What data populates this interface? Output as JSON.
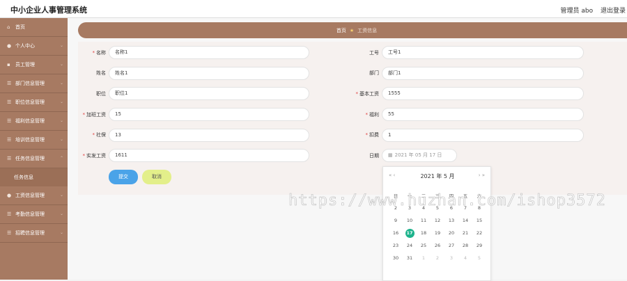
{
  "header": {
    "title": "中小企业人事管理系统",
    "user_label": "管理员 abo",
    "logout_label": "退出登录"
  },
  "sidebar": {
    "items": [
      {
        "label": "首页",
        "icon": "home-icon"
      },
      {
        "label": "个人中心",
        "icon": "user-icon"
      },
      {
        "label": "员工管理",
        "icon": "users-icon"
      },
      {
        "label": "部门信息管理",
        "icon": "list-icon"
      },
      {
        "label": "职位信息管理",
        "icon": "list-icon"
      },
      {
        "label": "福利信息管理",
        "icon": "list-icon"
      },
      {
        "label": "培训信息管理",
        "icon": "list-icon"
      },
      {
        "label": "任务信息管理",
        "icon": "list-icon"
      },
      {
        "label": "工资信息管理",
        "icon": "user-icon"
      },
      {
        "label": "考勤信息管理",
        "icon": "list-icon"
      },
      {
        "label": "招聘信息管理",
        "icon": "list-icon"
      }
    ],
    "sub_item": "任务信息"
  },
  "breadcrumb": {
    "home": "首页",
    "current": "工资信息"
  },
  "form": {
    "name": {
      "label": "名称",
      "value": "名称1"
    },
    "job_no": {
      "label": "工号",
      "value": "工号1"
    },
    "person_name": {
      "label": "姓名",
      "value": "姓名1"
    },
    "dept": {
      "label": "部门",
      "value": "部门1"
    },
    "position": {
      "label": "职位",
      "value": "职位1"
    },
    "base_salary": {
      "label": "基本工资",
      "value": "1555"
    },
    "overtime": {
      "label": "加班工资",
      "value": "15"
    },
    "welfare": {
      "label": "福利",
      "value": "55"
    },
    "social": {
      "label": "社保",
      "value": "13"
    },
    "deduction": {
      "label": "扣费",
      "value": "1"
    },
    "actual": {
      "label": "实发工资",
      "value": "1611"
    },
    "date": {
      "label": "日期",
      "value": "2021 年 05 月 17 日"
    },
    "submit_label": "提交",
    "cancel_label": "取消"
  },
  "calendar": {
    "title": "2021 年  5 月",
    "prev": "« ‹",
    "next": "› »",
    "weekdays": [
      "日",
      "一",
      "二",
      "三",
      "四",
      "五",
      "六"
    ],
    "weeks": [
      [
        "2",
        "3",
        "4",
        "5",
        "6",
        "7",
        "8"
      ],
      [
        "9",
        "10",
        "11",
        "12",
        "13",
        "14",
        "15"
      ],
      [
        "16",
        "17",
        "18",
        "19",
        "20",
        "21",
        "22"
      ],
      [
        "23",
        "24",
        "25",
        "26",
        "27",
        "28",
        "29"
      ],
      [
        "30",
        "31",
        "1",
        "2",
        "3",
        "4",
        "5"
      ]
    ],
    "selected": "17"
  },
  "watermark": "https://www.huzhan.com/ishop3572"
}
